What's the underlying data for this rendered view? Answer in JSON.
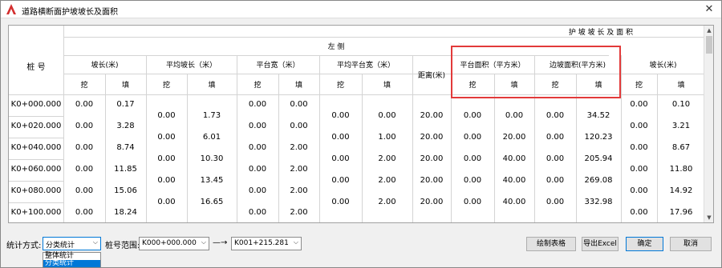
{
  "window": {
    "title": "道路横断面护坡坡长及面积",
    "close_glyph": "✕"
  },
  "table": {
    "header_top": "护 坡 坡 长 及 面 积",
    "side_left": "左  侧",
    "pile_header": "桩 号",
    "groups": [
      {
        "label": "坡长(米)"
      },
      {
        "label": "平均坡长（米）"
      },
      {
        "label": "平台宽（米）"
      },
      {
        "label": "平均平台宽（米）"
      },
      {
        "label": "距离(米)"
      },
      {
        "label": "平台面积（平方米）"
      },
      {
        "label": "边坡面积(平方米)"
      },
      {
        "label": "坡长(米)"
      }
    ],
    "sub_dig": "挖",
    "sub_fill": "填",
    "stations": [
      {
        "pile": "K0+000.000",
        "slope_dig": "0.00",
        "slope_fill": "0.17",
        "plat_dig": "0.00",
        "plat_fill": "0.00",
        "r_dig": "0.00",
        "r_fill": "0.10"
      },
      {
        "pile": "K0+020.000",
        "slope_dig": "0.00",
        "slope_fill": "3.28",
        "plat_dig": "0.00",
        "plat_fill": "0.00",
        "r_dig": "0.00",
        "r_fill": "3.21"
      },
      {
        "pile": "K0+040.000",
        "slope_dig": "0.00",
        "slope_fill": "8.74",
        "plat_dig": "0.00",
        "plat_fill": "2.00",
        "r_dig": "0.00",
        "r_fill": "8.67"
      },
      {
        "pile": "K0+060.000",
        "slope_dig": "0.00",
        "slope_fill": "11.85",
        "plat_dig": "0.00",
        "plat_fill": "2.00",
        "r_dig": "0.00",
        "r_fill": "11.80"
      },
      {
        "pile": "K0+080.000",
        "slope_dig": "0.00",
        "slope_fill": "15.06",
        "plat_dig": "0.00",
        "plat_fill": "2.00",
        "r_dig": "0.00",
        "r_fill": "14.92"
      },
      {
        "pile": "K0+100.000",
        "slope_dig": "0.00",
        "slope_fill": "18.24",
        "plat_dig": "0.00",
        "plat_fill": "2.00",
        "r_dig": "0.00",
        "r_fill": "17.96"
      }
    ],
    "intervals": [
      {
        "avg_slope_dig": "0.00",
        "avg_slope_fill": "1.73",
        "avg_plat_dig": "0.00",
        "avg_plat_fill": "0.00",
        "dist": "20.00",
        "parea_dig": "0.00",
        "parea_fill": "0.00",
        "sarea_dig": "0.00",
        "sarea_fill": "34.52"
      },
      {
        "avg_slope_dig": "0.00",
        "avg_slope_fill": "6.01",
        "avg_plat_dig": "0.00",
        "avg_plat_fill": "1.00",
        "dist": "20.00",
        "parea_dig": "0.00",
        "parea_fill": "20.00",
        "sarea_dig": "0.00",
        "sarea_fill": "120.23"
      },
      {
        "avg_slope_dig": "0.00",
        "avg_slope_fill": "10.30",
        "avg_plat_dig": "0.00",
        "avg_plat_fill": "2.00",
        "dist": "20.00",
        "parea_dig": "0.00",
        "parea_fill": "40.00",
        "sarea_dig": "0.00",
        "sarea_fill": "205.94"
      },
      {
        "avg_slope_dig": "0.00",
        "avg_slope_fill": "13.45",
        "avg_plat_dig": "0.00",
        "avg_plat_fill": "2.00",
        "dist": "20.00",
        "parea_dig": "0.00",
        "parea_fill": "40.00",
        "sarea_dig": "0.00",
        "sarea_fill": "269.08"
      },
      {
        "avg_slope_dig": "0.00",
        "avg_slope_fill": "16.65",
        "avg_plat_dig": "0.00",
        "avg_plat_fill": "2.00",
        "dist": "20.00",
        "parea_dig": "0.00",
        "parea_fill": "40.00",
        "sarea_dig": "0.00",
        "sarea_fill": "332.98"
      }
    ]
  },
  "bottom": {
    "stat_label": "统计方式:",
    "stat_value": "分类统计",
    "range_label": "桩号范围:",
    "range_from": "K000+000.000",
    "range_sep": "—→",
    "range_to": "K001+215.281",
    "btn_draw": "绘制表格",
    "btn_export": "导出Excel",
    "btn_ok": "确定",
    "btn_cancel": "取消",
    "dropdown_options": [
      "整体统计",
      "分类统计"
    ],
    "dropdown_selected": "分类统计"
  },
  "colors": {
    "accent": "#0078d7",
    "highlight": "#e23a3a",
    "app_icon": "#d32f2f"
  }
}
